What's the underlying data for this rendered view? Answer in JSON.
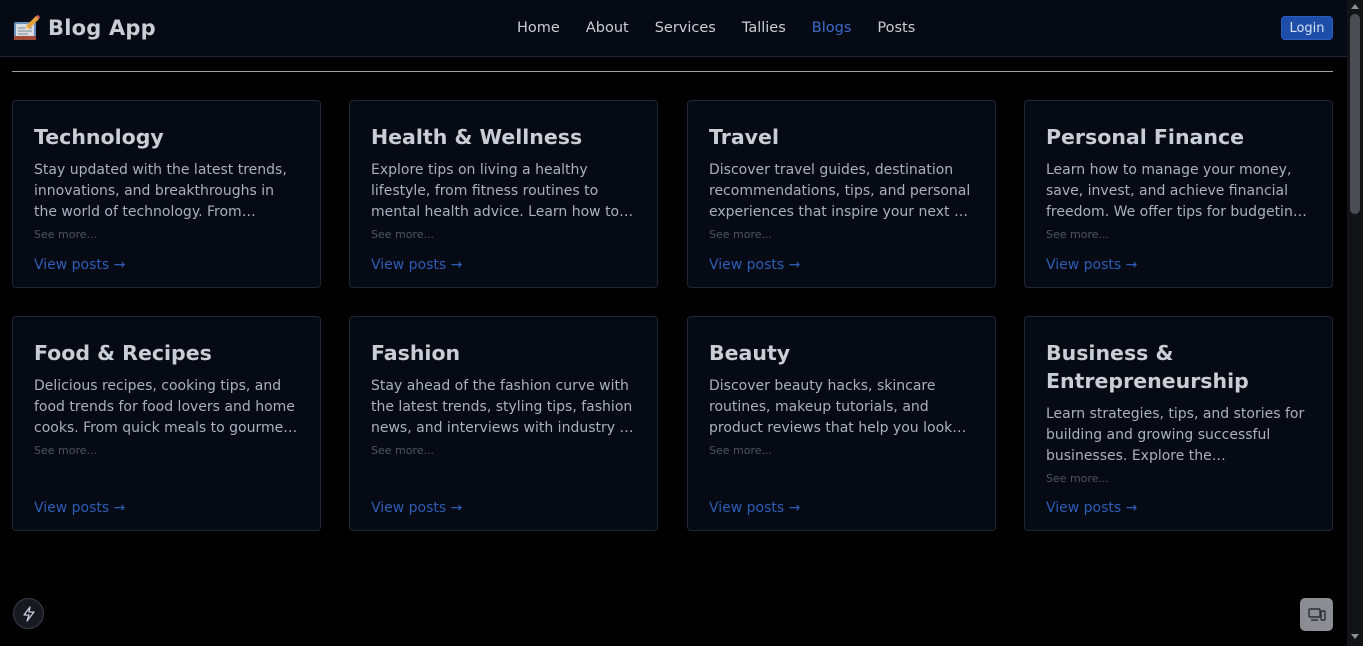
{
  "header": {
    "brand_name": "Blog App",
    "brand_icon": "notebook-pencil-logo",
    "nav": [
      {
        "label": "Home",
        "active": false
      },
      {
        "label": "About",
        "active": false
      },
      {
        "label": "Services",
        "active": false
      },
      {
        "label": "Tallies",
        "active": false
      },
      {
        "label": "Blogs",
        "active": true
      },
      {
        "label": "Posts",
        "active": false
      }
    ],
    "login_label": "Login"
  },
  "categories": [
    {
      "title": "Technology",
      "description": "Stay updated with the latest trends, innovations, and breakthroughs in the world of technology. From software to …",
      "see_more": "See more...",
      "link": "View posts →"
    },
    {
      "title": "Health & Wellness",
      "description": "Explore tips on living a healthy lifestyle, from fitness routines to mental health advice. Learn how to maintain balance …",
      "see_more": "See more...",
      "link": "View posts →"
    },
    {
      "title": "Travel",
      "description": "Discover travel guides, destination recommendations, tips, and personal experiences that inspire your next …",
      "see_more": "See more...",
      "link": "View posts →"
    },
    {
      "title": "Personal Finance",
      "description": "Learn how to manage your money, save, invest, and achieve financial freedom. We offer tips for budgeting, …",
      "see_more": "See more...",
      "link": "View posts →"
    },
    {
      "title": "Food & Recipes",
      "description": "Delicious recipes, cooking tips, and food trends for food lovers and home cooks. From quick meals to gourmet dishes, w…",
      "see_more": "See more...",
      "link": "View posts →"
    },
    {
      "title": "Fashion",
      "description": "Stay ahead of the fashion curve with the latest trends, styling tips, fashion news, and interviews with industry …",
      "see_more": "See more...",
      "link": "View posts →"
    },
    {
      "title": "Beauty",
      "description": "Discover beauty hacks, skincare routines, makeup tutorials, and product reviews that help you look and feel you…",
      "see_more": "See more...",
      "link": "View posts →"
    },
    {
      "title": "Business & Entrepreneurship",
      "description": "Learn strategies, tips, and stories for building and growing successful businesses. Explore the entrepreneurial …",
      "see_more": "See more...",
      "link": "View posts →"
    }
  ],
  "floating": {
    "left_icon": "lightning-bolt-icon",
    "right_icon": "devices-icon"
  },
  "colors": {
    "background": "#000000",
    "card_bg": "#050a14",
    "accent": "#2d5db5",
    "active_nav": "#3d6cc8",
    "login_bg": "#1f4ea8"
  }
}
